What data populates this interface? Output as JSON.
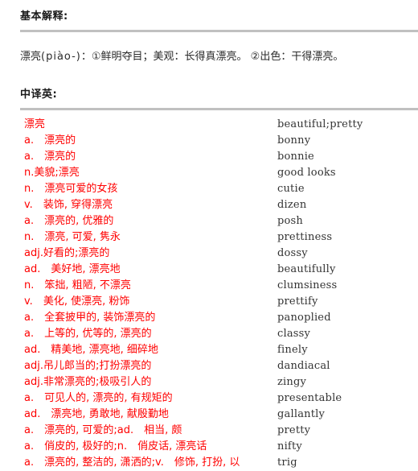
{
  "sections": {
    "basic": {
      "heading": "基本解释:",
      "definition_word": "漂亮",
      "definition_pinyin": "(piào-)",
      "definition_body": "：①鲜明夺目；美观：长得真漂亮。 ②出色：干得漂亮。"
    },
    "cn_to_en": {
      "heading": "中译英:",
      "headword": "漂亮",
      "rows": [
        {
          "cn": "漂亮",
          "en": "beautiful;pretty"
        },
        {
          "cn": "a.　漂亮的",
          "en": "bonny"
        },
        {
          "cn": "a.　漂亮的",
          "en": "bonnie"
        },
        {
          "cn": "n.美貌;漂亮",
          "en": "good looks"
        },
        {
          "cn": "n.　漂亮可爱的女孩",
          "en": "cutie"
        },
        {
          "cn": "v.　装饰, 穿得漂亮",
          "en": "dizen"
        },
        {
          "cn": "a.　漂亮的, 优雅的",
          "en": "posh"
        },
        {
          "cn": "n.　漂亮, 可爱, 隽永",
          "en": "prettiness"
        },
        {
          "cn": "adj.好看的;漂亮的",
          "en": "dossy"
        },
        {
          "cn": "ad.　美好地, 漂亮地",
          "en": "beautifully"
        },
        {
          "cn": "n.　笨拙, 粗陋, 不漂亮",
          "en": "clumsiness"
        },
        {
          "cn": "v.　美化, 使漂亮, 粉饰",
          "en": "prettify"
        },
        {
          "cn": "a.　全套披甲的, 装饰漂亮的",
          "en": "panoplied"
        },
        {
          "cn": "a.　上等的, 优等的, 漂亮的",
          "en": "classy"
        },
        {
          "cn": "ad.　精美地, 漂亮地, 细碎地",
          "en": "finely"
        },
        {
          "cn": "adj.吊儿郎当的;打扮漂亮的",
          "en": "dandiacal"
        },
        {
          "cn": "adj.非常漂亮的;极吸引人的",
          "en": "zingy"
        },
        {
          "cn": "a.　可见人的, 漂亮的, 有规矩的",
          "en": "presentable"
        },
        {
          "cn": "ad.　漂亮地, 勇敢地, 献殷勤地",
          "en": "gallantly"
        },
        {
          "cn": "a.　漂亮的, 可爱的;ad.　相当, 颇",
          "en": "pretty"
        },
        {
          "cn": "a.　俏皮的, 极好的;n.　俏皮话, 漂亮话",
          "en": "nifty"
        },
        {
          "cn": "a.　漂亮的, 整洁的, 潇洒的;v.　修饰, 打扮, 以",
          "en": "trig"
        }
      ]
    }
  },
  "colors": {
    "entry_red": "#ff0000",
    "divider_gray": "#c0c0c0",
    "english_text": "#333333",
    "heading_text": "#1a1a1a"
  }
}
